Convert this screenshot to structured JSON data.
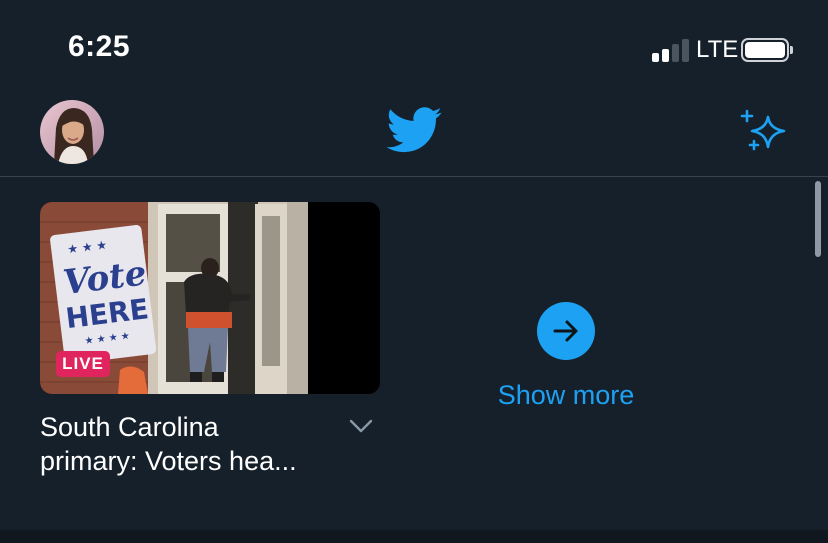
{
  "status_bar": {
    "time": "6:25",
    "network": "LTE",
    "signal_bars_active": 2,
    "signal_bars_total": 4,
    "battery_level": 1.0
  },
  "header": {
    "avatar_icon": "user-avatar",
    "logo_icon": "twitter-bird-icon",
    "action_icon": "sparkle-icon"
  },
  "carousel": {
    "item": {
      "badge": "LIVE",
      "title_line1": "South Carolina",
      "title_line2": "primary: Voters hea...",
      "sign_top": "Vote",
      "sign_bottom": "HERE"
    },
    "show_more": {
      "label": "Show more",
      "icon": "arrow-right-icon"
    }
  },
  "colors": {
    "background": "#15202b",
    "accent": "#1da1f2",
    "live": "#e0245e",
    "divider": "#38444d"
  }
}
